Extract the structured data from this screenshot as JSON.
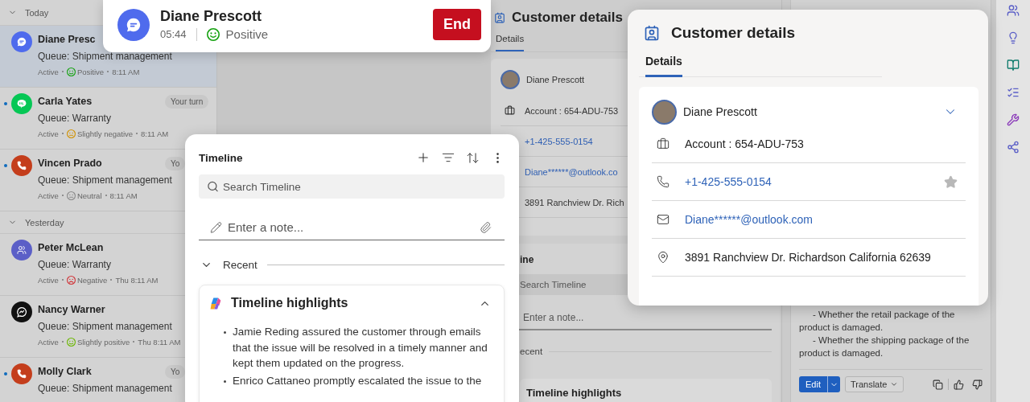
{
  "conversation_list": {
    "groups": [
      {
        "label": "Today",
        "expanded": true,
        "items": [
          {
            "name": "Diane Presc",
            "kind": "chat",
            "queue": "Queue: Shipment management",
            "status": "Active",
            "sentiment": {
              "kind": "positive",
              "label": "Positive"
            },
            "time": "8:11 AM",
            "selected": true,
            "unread": false
          },
          {
            "name": "Carla Yates",
            "kind": "line",
            "queue": "Queue: Warranty",
            "status": "Active",
            "sentiment": {
              "kind": "slightly_negative",
              "label": "Slightly negative"
            },
            "time": "8:11 AM",
            "badge": "Your turn",
            "selected": false,
            "unread": true
          },
          {
            "name": "Vincen Prado",
            "kind": "phone",
            "queue": "Queue: Shipment management",
            "status": "Active",
            "sentiment": {
              "kind": "neutral",
              "label": "Neutral"
            },
            "time": "8:11 AM",
            "badge": "Yo",
            "selected": false,
            "unread": true
          }
        ]
      },
      {
        "label": "Yesterday",
        "expanded": true,
        "items": [
          {
            "name": "Peter McLean",
            "kind": "teams",
            "queue": "Queue: Warranty",
            "status": "Active",
            "sentiment": {
              "kind": "negative",
              "label": "Negative"
            },
            "time": "Thu 8:11 AM",
            "selected": false,
            "unread": false
          },
          {
            "name": "Nancy Warner",
            "kind": "messenger",
            "queue": "Queue: Shipment management",
            "status": "Active",
            "sentiment": {
              "kind": "slightly_positive",
              "label": "Slightly positive"
            },
            "time": "Thu 8:11 AM",
            "selected": false,
            "unread": false
          },
          {
            "name": "Molly Clark",
            "kind": "phone",
            "queue": "Queue: Shipment management",
            "badge": "Yo",
            "selected": false,
            "unread": true
          }
        ]
      }
    ]
  },
  "active_call": {
    "name": "Diane Prescott",
    "kind": "chat",
    "duration": "05:44",
    "sentiment": {
      "kind": "positive",
      "label": "Positive"
    },
    "end_button": "End"
  },
  "background_customer_panel": {
    "title": "Customer details",
    "tabs": [
      {
        "label": "Details",
        "selected": true
      }
    ],
    "contact_name": "Diane Prescott",
    "rows": [
      {
        "kind": "account",
        "text": "Account : 654-ADU-753"
      },
      {
        "kind": "phone",
        "text": "+1-425-555-0154"
      },
      {
        "kind": "email",
        "text": "Diane******@outlook.co"
      },
      {
        "kind": "address",
        "text": "3891 Ranchview Dr. Rich"
      }
    ],
    "timeline_title": "ine",
    "search_placeholder": "Search Timeline",
    "note_placeholder": "Enter a note...",
    "recent_label": "ecent",
    "highlights_title": "Timeline highlights"
  },
  "copilot_panel": {
    "lines": [
      {
        "text": "- Whether the retail package of the",
        "indent": true
      },
      {
        "text": "product is damaged.",
        "indent": false
      },
      {
        "text": "- Whether the shipping package of the",
        "indent": true
      },
      {
        "text": "product is damaged.",
        "indent": false
      }
    ],
    "edit_button": "Edit",
    "translate_button": "Translate"
  },
  "timeline": {
    "title": "Timeline",
    "search_placeholder": "Search Timeline",
    "note_placeholder": "Enter a note...",
    "recent_label": "Recent",
    "recent_expanded": true,
    "highlights": {
      "title": "Timeline highlights",
      "expanded": true,
      "bullets": [
        "Jamie Reding assured the customer through emails that the issue will be resolved in a timely manner and kept them updated on the progress.",
        "Enrico Cattaneo promptly escalated the issue to the"
      ]
    }
  },
  "customer_details": {
    "title": "Customer details",
    "tabs": [
      {
        "label": "Details",
        "selected": true
      }
    ],
    "contact": {
      "name": "Diane Prescott",
      "expanded": true
    },
    "rows": [
      {
        "kind": "account",
        "text": "Account : 654-ADU-753"
      },
      {
        "kind": "phone",
        "text": "+1-425-555-0154"
      },
      {
        "kind": "email",
        "text": "Diane******@outlook.com"
      },
      {
        "kind": "address",
        "text": "3891 Ranchview Dr. Richardson California 62639"
      }
    ]
  }
}
